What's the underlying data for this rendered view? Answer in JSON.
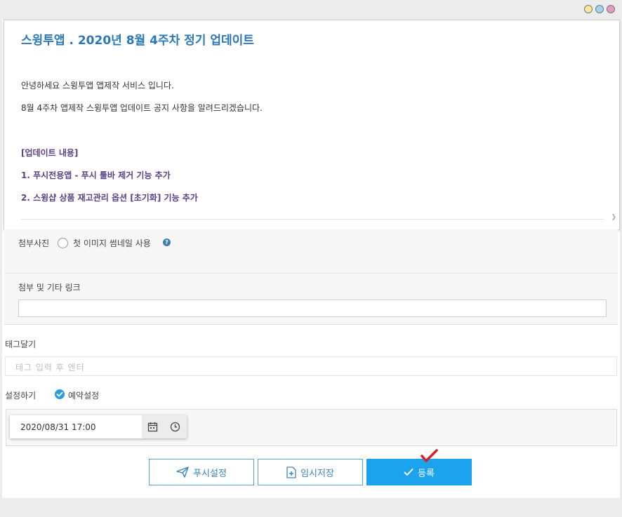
{
  "editor": {
    "title": "스윙투앱 . 2020년 8월 4주차 정기 업데이트",
    "greeting": "안녕하세요 스윙투앱 앱제작 서비스 입니다.",
    "intro": "8월 4주차 앱제작 스윙투앱 업데이트 공지 사항을 알려드리겠습니다.",
    "section_heading": "[업데이트 내용]",
    "item1": "1. 푸시전용앱 - 푸시 툴바 제거 기능 추가",
    "item2": "2. 스윙샵 상품 재고관리 옵션 [초기화] 기능 추가"
  },
  "attach_photo": {
    "label": "첨부사진",
    "thumbnail_option": "첫 이미지 썸네일 사용",
    "help_glyph": "?"
  },
  "links": {
    "label": "첨부 및 기타 링크",
    "value": ""
  },
  "tags": {
    "label": "태그달기",
    "placeholder": "태그 입력 후 엔터"
  },
  "settings": {
    "label": "설정하기",
    "reservation_label": "예약설정",
    "reservation_checked": true,
    "datetime": "2020/08/31 17:00"
  },
  "buttons": {
    "push": "푸시설정",
    "temp_save": "임시저장",
    "submit": "등록"
  },
  "colors": {
    "accent": "#1ba3ee",
    "title": "#2b78b8",
    "purple_text": "#5b4185",
    "marker": "#d8202a"
  },
  "icons": {
    "push": "paper-plane-icon",
    "temp_save": "file-plus-icon",
    "submit": "check-icon",
    "calendar": "calendar-icon",
    "clock": "clock-icon"
  }
}
